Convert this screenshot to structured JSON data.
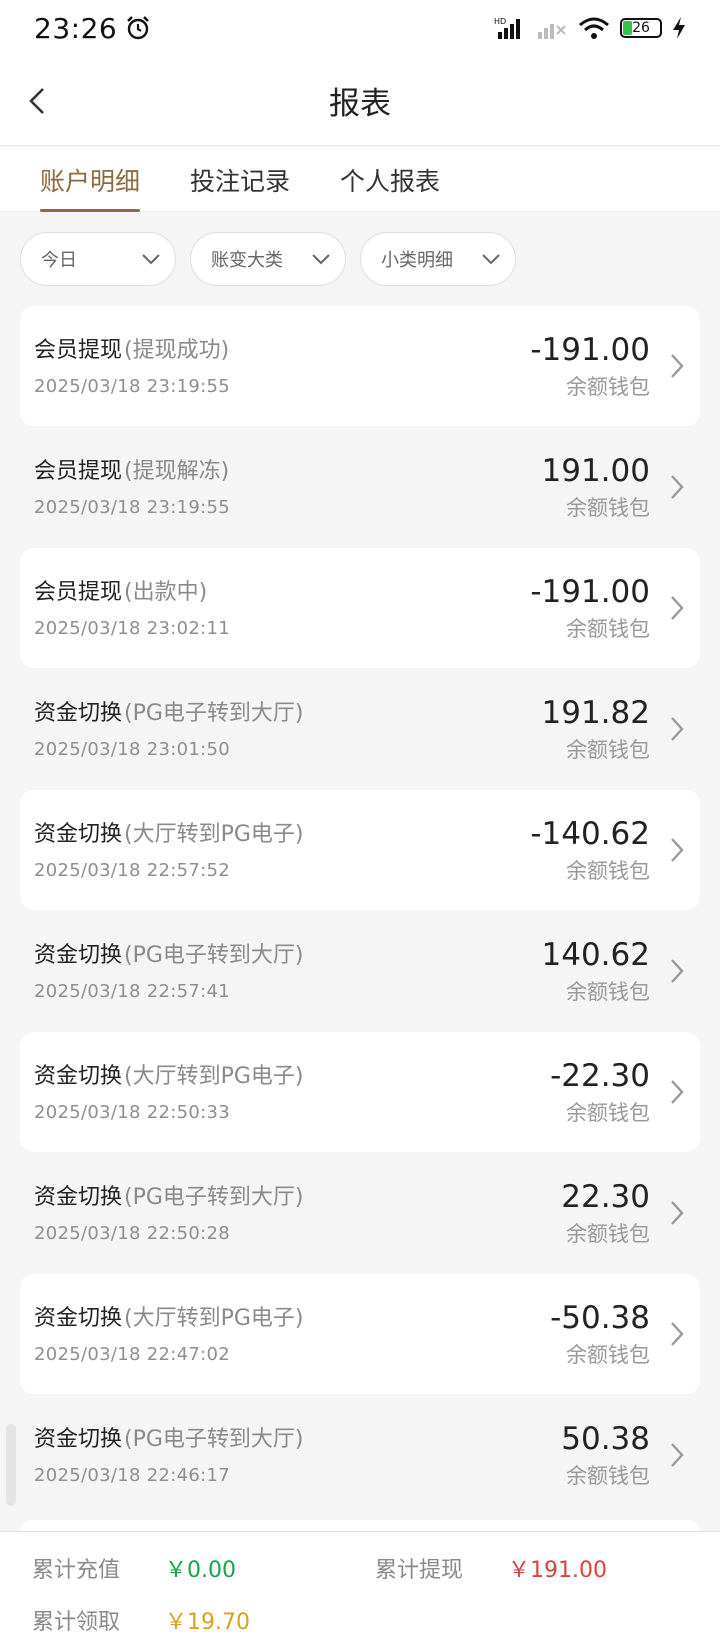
{
  "status": {
    "time": "23:26",
    "battery": "26"
  },
  "header": {
    "title": "报表"
  },
  "tabs": [
    {
      "label": "账户明细",
      "active": true
    },
    {
      "label": "投注记录",
      "active": false
    },
    {
      "label": "个人报表",
      "active": false
    }
  ],
  "filters": [
    {
      "label": "今日"
    },
    {
      "label": "账变大类"
    },
    {
      "label": "小类明细"
    }
  ],
  "records": [
    {
      "title": "会员提现",
      "sub": "(提现成功)",
      "date": "2025/03/18 23:19:55",
      "amount": "-191.00",
      "wallet": "余额钱包"
    },
    {
      "title": "会员提现",
      "sub": "(提现解冻)",
      "date": "2025/03/18 23:19:55",
      "amount": "191.00",
      "wallet": "余额钱包"
    },
    {
      "title": "会员提现",
      "sub": "(出款中)",
      "date": "2025/03/18 23:02:11",
      "amount": "-191.00",
      "wallet": "余额钱包"
    },
    {
      "title": "资金切换",
      "sub": "(PG电子转到大厅)",
      "date": "2025/03/18 23:01:50",
      "amount": "191.82",
      "wallet": "余额钱包"
    },
    {
      "title": "资金切换",
      "sub": "(大厅转到PG电子)",
      "date": "2025/03/18 22:57:52",
      "amount": "-140.62",
      "wallet": "余额钱包"
    },
    {
      "title": "资金切换",
      "sub": "(PG电子转到大厅)",
      "date": "2025/03/18 22:57:41",
      "amount": "140.62",
      "wallet": "余额钱包"
    },
    {
      "title": "资金切换",
      "sub": "(大厅转到PG电子)",
      "date": "2025/03/18 22:50:33",
      "amount": "-22.30",
      "wallet": "余额钱包"
    },
    {
      "title": "资金切换",
      "sub": "(PG电子转到大厅)",
      "date": "2025/03/18 22:50:28",
      "amount": "22.30",
      "wallet": "余额钱包"
    },
    {
      "title": "资金切换",
      "sub": "(大厅转到PG电子)",
      "date": "2025/03/18 22:47:02",
      "amount": "-50.38",
      "wallet": "余额钱包"
    },
    {
      "title": "资金切换",
      "sub": "(PG电子转到大厅)",
      "date": "2025/03/18 22:46:17",
      "amount": "50.38",
      "wallet": "余额钱包"
    }
  ],
  "summary": {
    "deposit_label": "累计充值",
    "deposit_value": "￥0.00",
    "withdraw_label": "累计提现",
    "withdraw_value": "￥191.00",
    "claim_label": "累计领取",
    "claim_value": "￥19.70"
  },
  "colors": {
    "accent": "#8a6b43",
    "positive": "#19a44a",
    "negative": "#d8433a",
    "reward": "#d9a21b"
  }
}
